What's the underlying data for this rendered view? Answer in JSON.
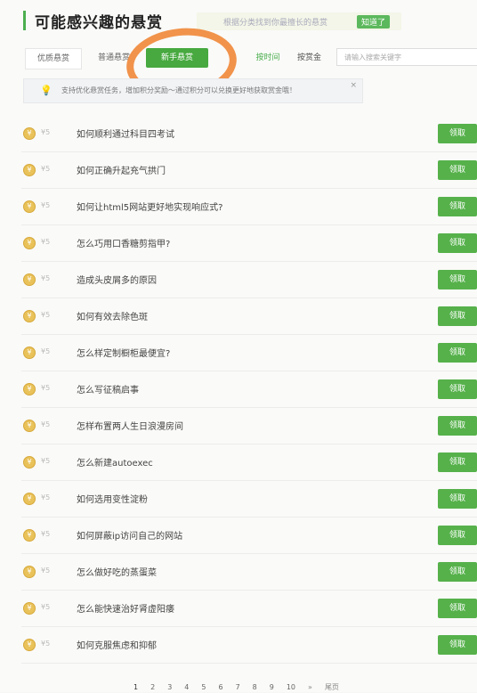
{
  "header": {
    "title": "可能感兴趣的悬赏",
    "subtitle": "根据分类找到你最擅长的悬赏",
    "know_label": "知道了"
  },
  "tabs": {
    "t1": "优质悬赏",
    "t2": "普通悬赏",
    "t3": "新手悬赏",
    "t4": "按时间"
  },
  "filter": {
    "label": "按赏金",
    "search_placeholder": "请输入搜索关键字"
  },
  "notice": {
    "text": "支持优化悬赏任务，增加积分奖励～通过积分可以兑换更好地获取赏金哦！",
    "close": "×"
  },
  "rows": [
    {
      "amount": "¥5",
      "question": "如何顺利通过科目四考试",
      "action": "领取"
    },
    {
      "amount": "¥5",
      "question": "如何正确升起充气拱门",
      "action": "领取"
    },
    {
      "amount": "¥5",
      "question": "如何让html5网站更好地实现响应式?",
      "action": "领取"
    },
    {
      "amount": "¥5",
      "question": "怎么巧用口香糖剪指甲?",
      "action": "领取"
    },
    {
      "amount": "¥5",
      "question": "造成头皮屑多的原因",
      "action": "领取"
    },
    {
      "amount": "¥5",
      "question": "如何有效去除色斑",
      "action": "领取"
    },
    {
      "amount": "¥5",
      "question": "怎么样定制橱柜最便宜?",
      "action": "领取"
    },
    {
      "amount": "¥5",
      "question": "怎么写征稿启事",
      "action": "领取"
    },
    {
      "amount": "¥5",
      "question": "怎样布置两人生日浪漫房间",
      "action": "领取"
    },
    {
      "amount": "¥5",
      "question": "怎么新建autoexec",
      "action": "领取"
    },
    {
      "amount": "¥5",
      "question": "如何选用变性淀粉",
      "action": "领取"
    },
    {
      "amount": "¥5",
      "question": "如何屏蔽ip访问自己的网站",
      "action": "领取"
    },
    {
      "amount": "¥5",
      "question": "怎么做好吃的蒸蛋菜",
      "action": "领取"
    },
    {
      "amount": "¥5",
      "question": "怎么能快速治好肾虚阳痿",
      "action": "领取"
    },
    {
      "amount": "¥5",
      "question": "如何克服焦虑和抑郁",
      "action": "领取"
    }
  ],
  "pagination": {
    "pages": [
      "1",
      "2",
      "3",
      "4",
      "5",
      "6",
      "7",
      "8",
      "9",
      "10"
    ],
    "next": "»",
    "last": "尾页"
  }
}
